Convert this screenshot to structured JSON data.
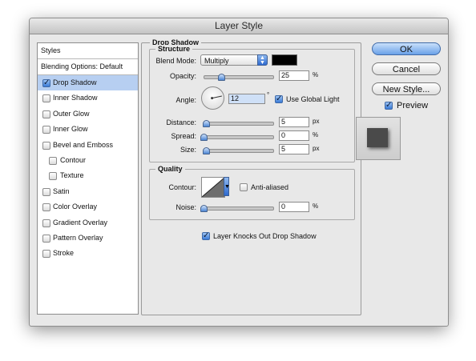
{
  "window": {
    "title": "Layer Style"
  },
  "sidebar": {
    "header": "Styles",
    "blending_options": "Blending Options: Default",
    "items": [
      {
        "label": "Drop Shadow",
        "checked": true,
        "selected": true,
        "indent": false
      },
      {
        "label": "Inner Shadow",
        "checked": false,
        "selected": false,
        "indent": false
      },
      {
        "label": "Outer Glow",
        "checked": false,
        "selected": false,
        "indent": false
      },
      {
        "label": "Inner Glow",
        "checked": false,
        "selected": false,
        "indent": false
      },
      {
        "label": "Bevel and Emboss",
        "checked": false,
        "selected": false,
        "indent": false
      },
      {
        "label": "Contour",
        "checked": false,
        "selected": false,
        "indent": true
      },
      {
        "label": "Texture",
        "checked": false,
        "selected": false,
        "indent": true
      },
      {
        "label": "Satin",
        "checked": false,
        "selected": false,
        "indent": false
      },
      {
        "label": "Color Overlay",
        "checked": false,
        "selected": false,
        "indent": false
      },
      {
        "label": "Gradient Overlay",
        "checked": false,
        "selected": false,
        "indent": false
      },
      {
        "label": "Pattern Overlay",
        "checked": false,
        "selected": false,
        "indent": false
      },
      {
        "label": "Stroke",
        "checked": false,
        "selected": false,
        "indent": false
      }
    ]
  },
  "drop_shadow": {
    "section_title": "Drop Shadow",
    "structure_title": "Structure",
    "blend_mode_label": "Blend Mode:",
    "blend_mode_value": "Multiply",
    "shadow_color": "#000000",
    "opacity_label": "Opacity:",
    "opacity_value": "25",
    "opacity_unit": "%",
    "angle_label": "Angle:",
    "angle_value": "12",
    "angle_unit": "°",
    "use_global_light_label": "Use Global Light",
    "use_global_light": true,
    "distance_label": "Distance:",
    "distance_value": "5",
    "distance_unit": "px",
    "spread_label": "Spread:",
    "spread_value": "0",
    "spread_unit": "%",
    "size_label": "Size:",
    "size_value": "5",
    "size_unit": "px",
    "quality_title": "Quality",
    "contour_label": "Contour:",
    "anti_aliased_label": "Anti-aliased",
    "anti_aliased": false,
    "noise_label": "Noise:",
    "noise_value": "0",
    "noise_unit": "%",
    "knockout_label": "Layer Knocks Out Drop Shadow",
    "knockout": true
  },
  "buttons": {
    "ok": "OK",
    "cancel": "Cancel",
    "new_style": "New Style...",
    "preview_label": "Preview",
    "preview_checked": true
  },
  "colors": {
    "accent_blue": "#6aa1e8",
    "selection": "#b7cff1"
  }
}
